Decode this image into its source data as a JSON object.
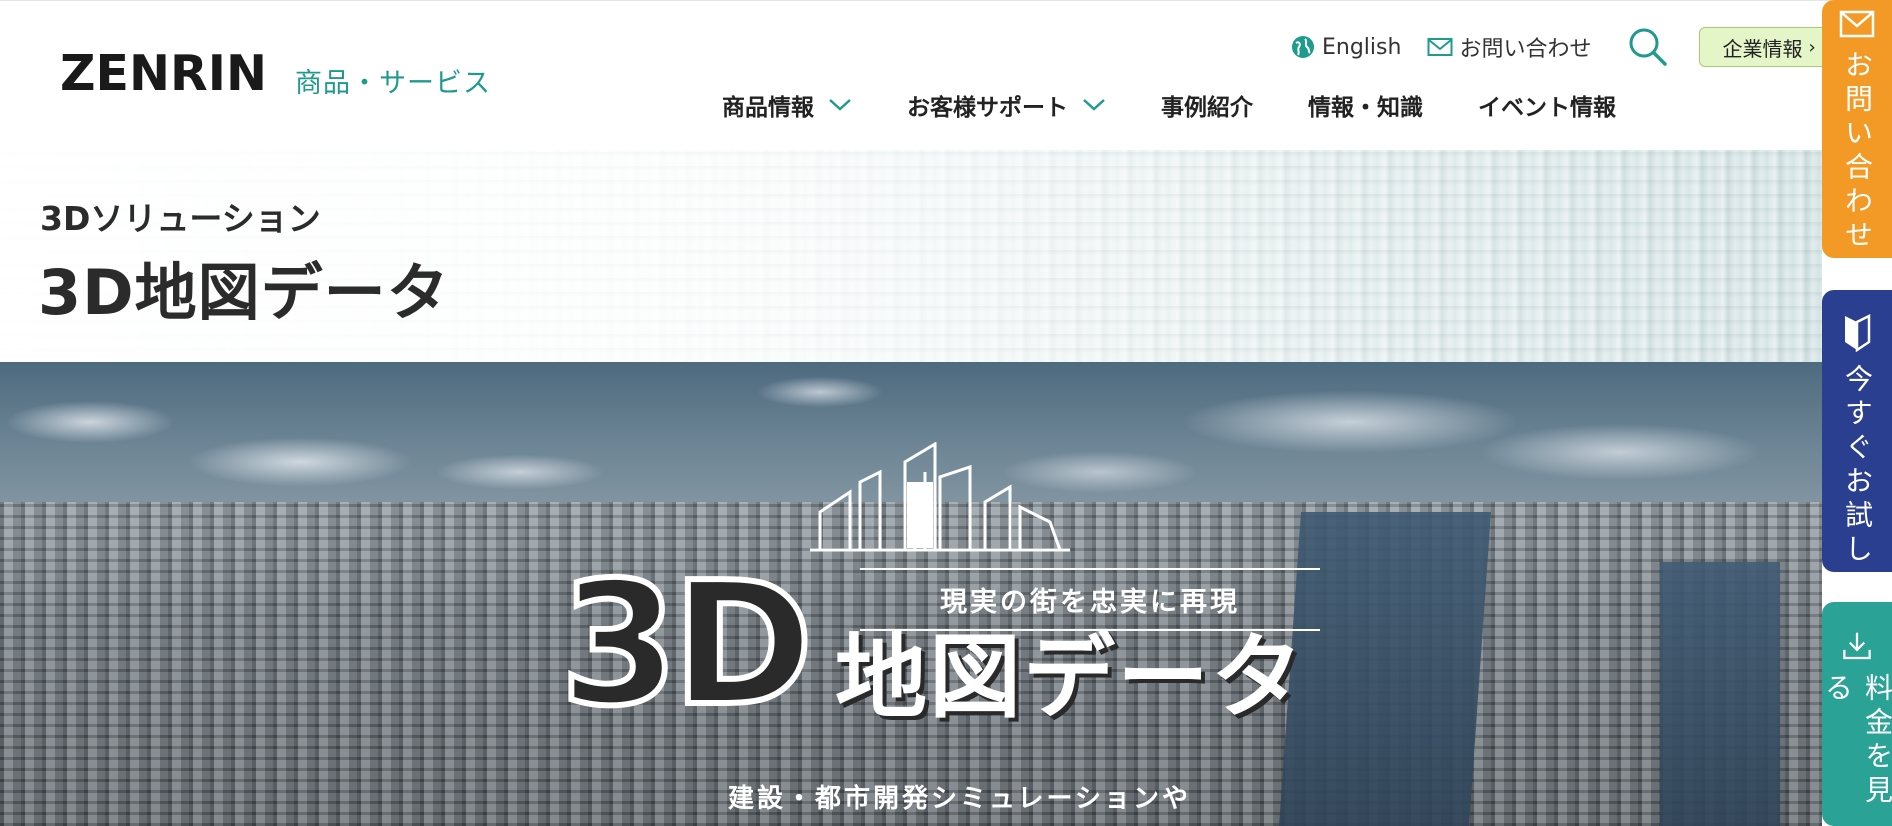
{
  "header": {
    "logo_text": "ZENRIN",
    "service_label": "商品・サービス",
    "util": {
      "english_label": "English",
      "contact_label": "お問い合わせ",
      "corp_label": "企業情報"
    },
    "nav": [
      {
        "label": "商品情報"
      },
      {
        "label": "お客様サポート"
      },
      {
        "label": "事例紹介"
      },
      {
        "label": "情報・知識"
      },
      {
        "label": "イベント情報"
      }
    ]
  },
  "title_band": {
    "subtitle": "3Dソリューション",
    "title": "3D地図データ"
  },
  "hero": {
    "big_3d": "3D",
    "tagline": "現実の街を忠実に再現",
    "main_title": "地図データ",
    "caption": "建設・都市開発シミュレーションや"
  },
  "side_tabs": {
    "contact": "お問い合わせ",
    "trial": "今すぐお試し",
    "price": "料金を見る"
  },
  "colors": {
    "teal": "#1f9a8e",
    "orange_tab": "#f39a26",
    "navy_tab": "#2a3f8f",
    "green_tab": "#2aa295",
    "corp_button_bg": "#e4f5c8"
  }
}
